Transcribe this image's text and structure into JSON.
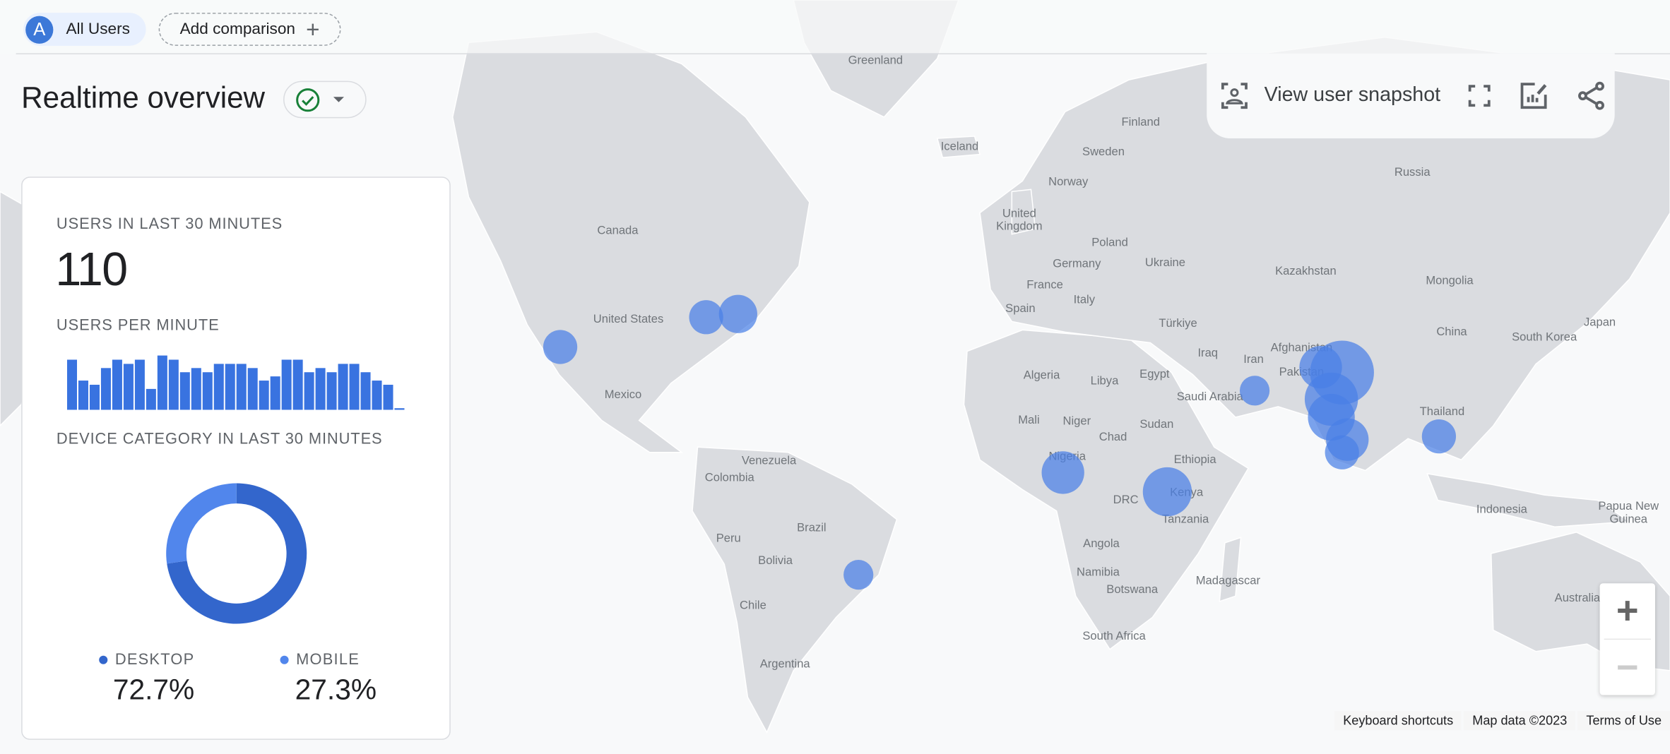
{
  "header": {
    "segment_chip": {
      "avatar_letter": "A",
      "label": "All Users"
    },
    "add_comparison_label": "Add comparison",
    "add_icon": "plus-icon",
    "page_title": "Realtime overview",
    "status_icon": "check-circle-icon",
    "status_color": "#188038"
  },
  "toolbar": {
    "snapshot_label": "View user snapshot",
    "icons": [
      "user-snapshot-icon",
      "fullscreen-icon",
      "customize-report-icon",
      "share-icon"
    ]
  },
  "card": {
    "users_label": "USERS IN LAST 30 MINUTES",
    "users_value": "110",
    "per_minute_label": "USERS PER MINUTE",
    "device_label": "DEVICE CATEGORY IN LAST 30 MINUTES",
    "devices": [
      {
        "name": "DESKTOP",
        "value": "72.7%",
        "color": "#3366cc"
      },
      {
        "name": "MOBILE",
        "value": "27.3%",
        "color": "#5186ec"
      }
    ]
  },
  "chart_data": [
    {
      "type": "bar",
      "title": "USERS PER MINUTE",
      "values": [
        12,
        7,
        6,
        10,
        12,
        11,
        12,
        5,
        13,
        12,
        9,
        10,
        9,
        11,
        11,
        11,
        10,
        7,
        8,
        12,
        12,
        9,
        10,
        9,
        11,
        11,
        9,
        7,
        6,
        0
      ],
      "ylim": [
        0,
        13
      ],
      "color": "#3973e0"
    },
    {
      "type": "pie",
      "title": "DEVICE CATEGORY IN LAST 30 MINUTES",
      "categories": [
        "DESKTOP",
        "MOBILE"
      ],
      "values": [
        72.7,
        27.3
      ],
      "colors": [
        "#3366cc",
        "#5186ec"
      ],
      "donut": true
    }
  ],
  "map": {
    "labels": [
      "Greenland",
      "Iceland",
      "Finland",
      "Sweden",
      "Norway",
      "Russia",
      "United Kingdom",
      "Poland",
      "Germany",
      "Ukraine",
      "France",
      "Kazakhstan",
      "Mongolia",
      "Italy",
      "Spain",
      "Türkiye",
      "Japan",
      "China",
      "South Korea",
      "Iraq",
      "Iran",
      "Afghanistan",
      "Pakistan",
      "Algeria",
      "Libya",
      "Egypt",
      "Saudi Arabia",
      "Thailand",
      "Mali",
      "Niger",
      "Chad",
      "Sudan",
      "Ethiopia",
      "Nigeria",
      "Kenya",
      "DRC",
      "Tanzania",
      "Indonesia",
      "Papua New Guinea",
      "Angola",
      "Namibia",
      "Botswana",
      "Madagascar",
      "South Africa",
      "Australia",
      "Canada",
      "United States",
      "Mexico",
      "Venezuela",
      "Colombia",
      "Brazil",
      "Peru",
      "Bolivia",
      "Chile",
      "Argentina"
    ],
    "bubble_color": "#4a7fe6",
    "zoom_in": "+",
    "zoom_out": "−",
    "attribution": {
      "shortcuts": "Keyboard shortcuts",
      "map_data": "Map data ©2023",
      "terms": "Terms of Use"
    }
  }
}
